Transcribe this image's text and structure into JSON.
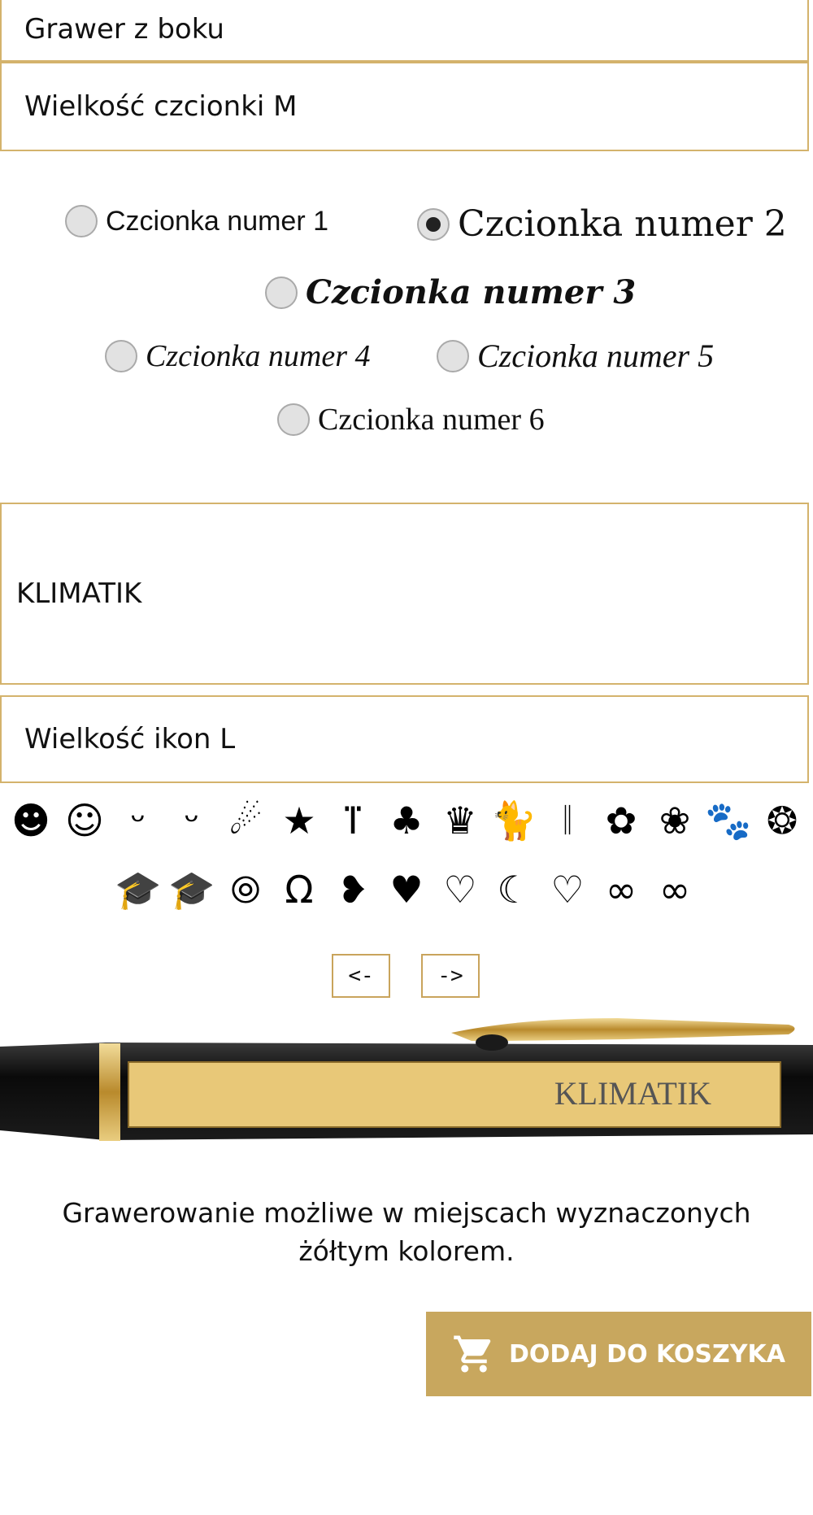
{
  "fields": {
    "engraving_side": "Grawer z boku",
    "font_size": "Wielkość czcionki M",
    "engraving_text": "KLIMATIK",
    "icon_size": "Wielkość ikon L"
  },
  "fonts": {
    "selected": "Czcionka numer 2",
    "options": [
      "Czcionka numer 1",
      "Czcionka numer 2",
      "Czcionka numer 3",
      "Czcionka numer 4",
      "Czcionka numer 5",
      "Czcionka numer 6"
    ]
  },
  "icons": {
    "row1": [
      "☻",
      "☺",
      "ᵕ",
      "ᵕ",
      "☄",
      "★",
      "ⴶ",
      "♣",
      "♛",
      "🐈",
      "𝄁",
      "✿",
      "❀",
      "🐾",
      "❂"
    ],
    "row2": [
      "🎓",
      "🎓",
      "⦾",
      "Ω",
      "❥",
      "♥",
      "♡",
      "☾",
      "♡",
      "∞",
      "∞"
    ],
    "names_row1": [
      "grinning-face-icon",
      "smiling-face-icon",
      "smile-face-icon",
      "heart-eyes-smile-icon",
      "shooting-star-icon",
      "star-icon",
      "ihs-cross-icon",
      "four-leaf-clover-icon",
      "crown-icon",
      "cat-icon",
      "tie-icon",
      "rose-icon",
      "rose-bud-icon",
      "paw-icon",
      "rosette-icon"
    ],
    "names_row2": [
      "graduation-cap-icon",
      "graduation-cap-2-icon",
      "wedding-rings-icon",
      "horseshoe-icon",
      "heart-drop-icon",
      "heart-filled-icon",
      "heart-outline-icon",
      "heart-half-icon",
      "heart-double-icon",
      "infinity-icon",
      "infinity-thin-icon"
    ]
  },
  "nav": {
    "prev": "<-",
    "next": "->"
  },
  "preview": {
    "engraving_text": "KLIMATIK"
  },
  "notice": "Grawerowanie możliwe w miejscach wyznaczonych żółtym kolorem.",
  "cart": {
    "button_label": "DODAJ DO KOSZYKA"
  },
  "colors": {
    "accent": "#c8a75e",
    "border": "#d4b36c",
    "engraving_area": "#e8c878"
  }
}
